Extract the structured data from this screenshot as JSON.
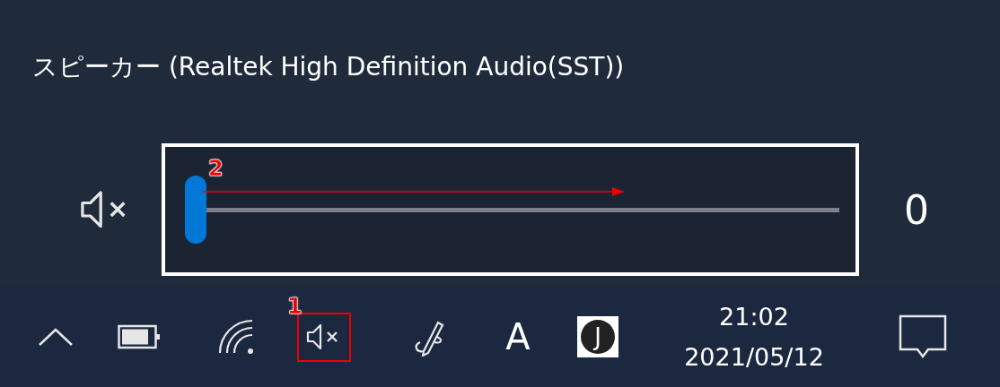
{
  "flyout": {
    "title": "スピーカー (Realtek High Definition Audio(SST))",
    "muted": true,
    "volume": {
      "level": 0,
      "reading": "0",
      "callout": "2"
    }
  },
  "taskbar": {
    "items": [
      {
        "kind": "chevron"
      },
      {
        "kind": "battery"
      },
      {
        "kind": "wifi"
      },
      {
        "kind": "volume",
        "muted": true,
        "callout": "1"
      },
      {
        "kind": "pen"
      },
      {
        "kind": "ime_mode",
        "text": "A"
      },
      {
        "kind": "ime_badge",
        "text": "J"
      }
    ],
    "clock": {
      "time": "21:02",
      "date": "2021/05/12"
    }
  }
}
